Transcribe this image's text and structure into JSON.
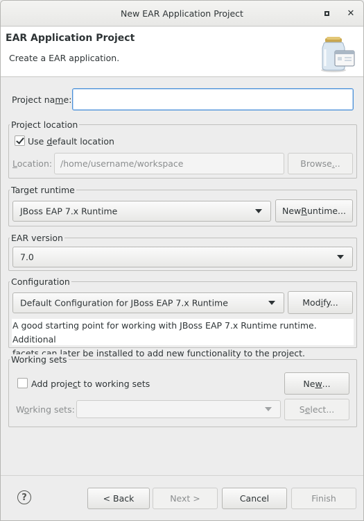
{
  "window": {
    "title": "New EAR Application Project"
  },
  "header": {
    "title": "EAR Application Project",
    "description": "Create a EAR application."
  },
  "project_name": {
    "label_pre": "Project na",
    "label_mnemonic": "m",
    "label_post": "e:",
    "value": ""
  },
  "project_location": {
    "group_title": "Project location",
    "use_default_pre": "Use ",
    "use_default_mnemonic": "d",
    "use_default_post": "efault location",
    "use_default_checked": true,
    "location_label_mnemonic": "L",
    "location_label_post": "ocation:",
    "location_value": "/home/username/workspace",
    "browse_pre": "Browse",
    "browse_mnemonic": ".",
    "browse_post": ".."
  },
  "target_runtime": {
    "group_title": "Target runtime",
    "selected": "JBoss EAP 7.x Runtime",
    "new_runtime_pre": "New ",
    "new_runtime_mnemonic": "R",
    "new_runtime_post": "untime..."
  },
  "ear_version": {
    "group_title": "EAR version",
    "selected": "7.0"
  },
  "configuration": {
    "group_title": "Configuration",
    "selected": "Default Configuration for JBoss EAP 7.x Runtime",
    "modify_pre": "Mod",
    "modify_mnemonic": "i",
    "modify_post": "fy...",
    "description_line1": "A good starting point for working with JBoss EAP 7.x Runtime runtime. Additional",
    "description_line2": "facets can later be installed to add new functionality to the project."
  },
  "working_sets": {
    "group_title": "Working sets",
    "add_pre": "Add proje",
    "add_mnemonic": "c",
    "add_post": "t to working sets",
    "add_checked": false,
    "new_pre": "Ne",
    "new_mnemonic": "w",
    "new_post": "...",
    "ws_label_pre": "W",
    "ws_label_mnemonic": "o",
    "ws_label_post": "rking sets:",
    "ws_value": "",
    "select_pre": "S",
    "select_mnemonic": "e",
    "select_post": "lect..."
  },
  "footer": {
    "back": "< Back",
    "next": "Next >",
    "cancel": "Cancel",
    "finish": "Finish"
  },
  "icons": {
    "help": "?",
    "close": "✕"
  }
}
